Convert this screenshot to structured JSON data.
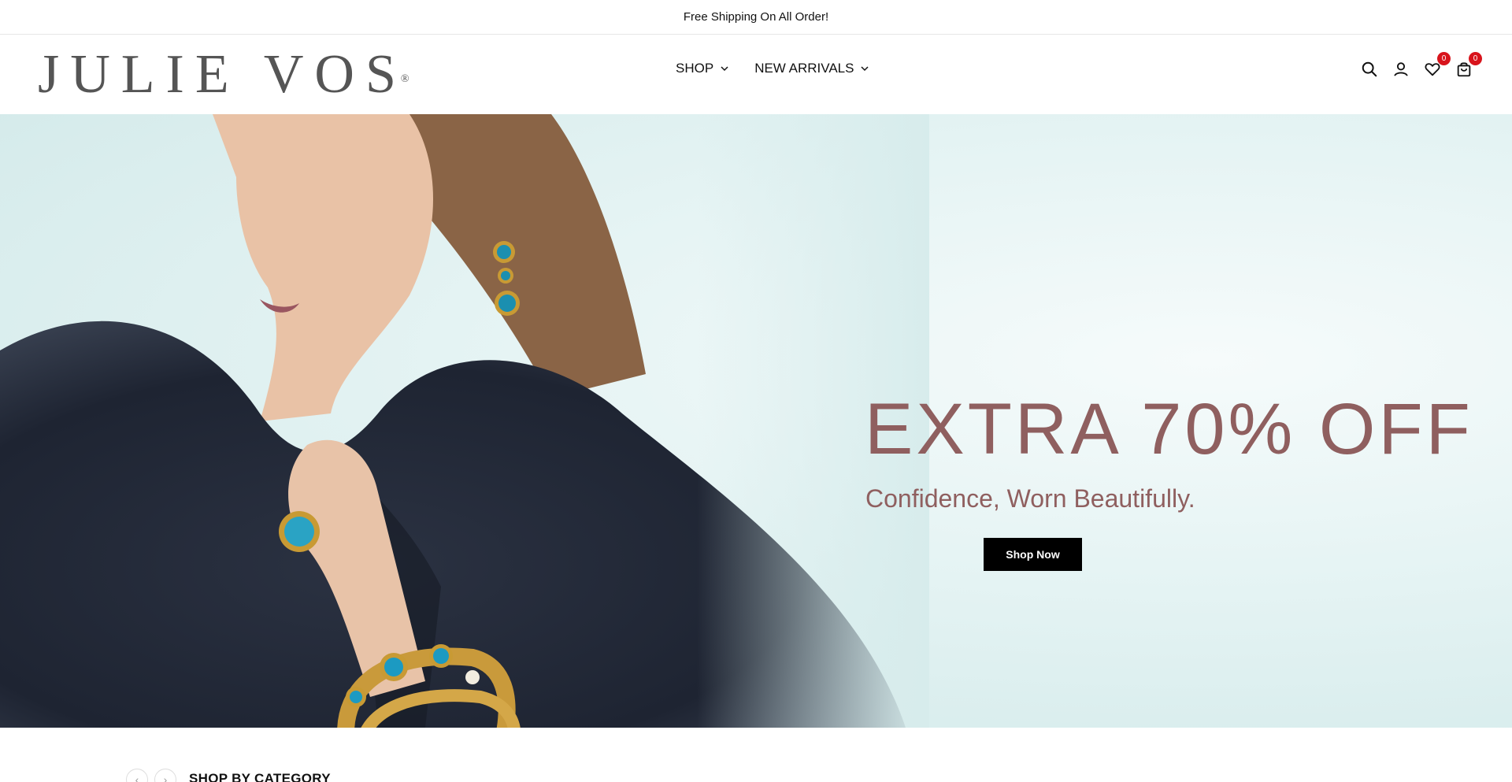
{
  "announcement": {
    "text": "Free Shipping On All Order!"
  },
  "header": {
    "logo": {
      "text": "JULIE VOS",
      "mark": "®"
    },
    "nav": [
      {
        "label": "SHOP"
      },
      {
        "label": "NEW ARRIVALS"
      }
    ],
    "icons": {
      "search": "search-icon",
      "account": "user-icon",
      "wishlist": {
        "icon": "heart-icon",
        "count": "0"
      },
      "cart": {
        "icon": "shopping-bag-icon",
        "count": "0"
      }
    }
  },
  "hero": {
    "title": "EXTRA 70% OFF",
    "subtitle": "Confidence, Worn Beautifully.",
    "cta_label": "Shop Now",
    "text_color": "#8f5f5f"
  },
  "category": {
    "title": "SHOP BY CATEGORY",
    "prev_icon": "chevron-left-icon",
    "next_icon": "chevron-right-icon"
  },
  "colors": {
    "badge": "#d8141c",
    "button": "#000000"
  }
}
